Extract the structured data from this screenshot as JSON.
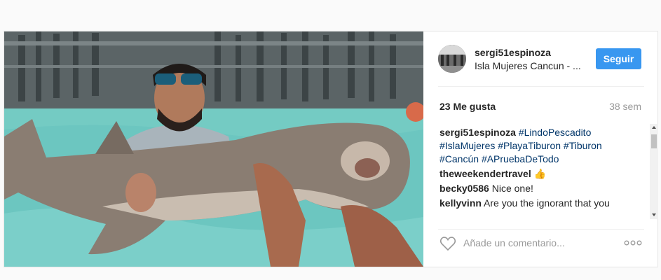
{
  "photo": {
    "description_icon": "shark-photo"
  },
  "header": {
    "username": "sergi51espinoza",
    "location": "Isla Mujeres Cancun - ...",
    "follow_label": "Seguir"
  },
  "stats": {
    "likes": "23 Me gusta",
    "time": "38 sem"
  },
  "caption": {
    "user": "sergi51espinoza",
    "hashtags": [
      "#LindoPescadito",
      "#IslaMujeres",
      "#PlayaTiburon",
      "#Tiburon",
      "#Cancún",
      "#APruebaDeTodo"
    ]
  },
  "comments": [
    {
      "user": "theweekendertravel",
      "text": "👍"
    },
    {
      "user": "becky0586",
      "text": "Nice one!"
    },
    {
      "user": "kellyvinn",
      "text": "Are you the ignorant that you"
    }
  ],
  "add_comment": {
    "placeholder": "Añade un comentario..."
  },
  "colors": {
    "follow_button": "#3897f0",
    "hashtag": "#003569",
    "muted": "#999999"
  }
}
